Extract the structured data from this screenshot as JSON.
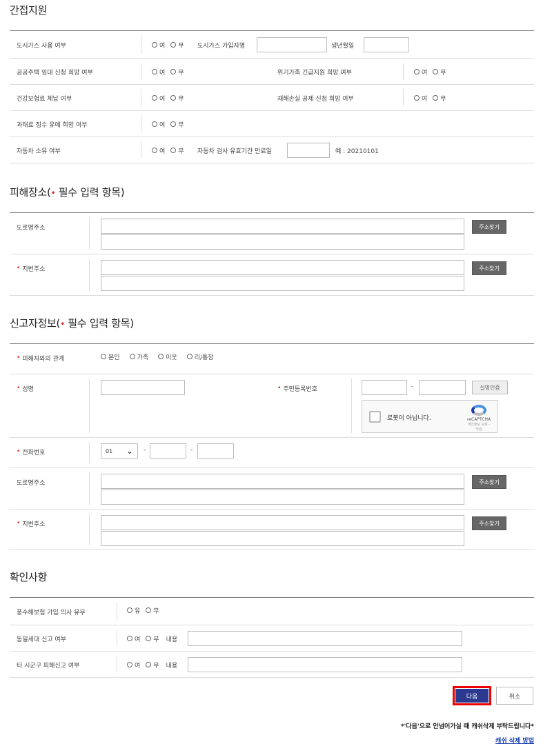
{
  "sec1": {
    "title": "간접지원",
    "yes": "여",
    "no": "무",
    "rows": [
      {
        "label": "도시가스 사용 여부",
        "sub1": "도시가스 가입자명",
        "sub2": "생년월일"
      },
      {
        "label": "공공주택 임대 신청 희망 여부",
        "right_label": "위기가족 긴급지원 희망 여부"
      },
      {
        "label": "건강보험료 체납 여부",
        "right_label": "재해손실 공제 신청 희망 여부"
      },
      {
        "label": "과태료 징수 유예 희망 여부"
      },
      {
        "label": "자동차 소유 여부",
        "sub1": "자동차 검사 유효기간 만료일",
        "example": "예 : 20210101"
      }
    ]
  },
  "sec2": {
    "title_prefix": "피해장소(",
    "star": "•",
    "title_suffix": " 필수 입력 항목)",
    "road_label": "도로명주소",
    "jibun_label": "지번주소",
    "find_btn": "주소찾기"
  },
  "sec3": {
    "title_prefix": "신고자정보(",
    "star": "•",
    "title_suffix": " 필수 입력 항목)",
    "relation_label": "피해자와의 관계",
    "relation_options": [
      "본인",
      "가족",
      "이웃",
      "리/통장"
    ],
    "name_label": "성명",
    "rrn_label": "주민등록번호",
    "verify_btn": "실명인증",
    "captcha_text": "로봇이 아닙니다.",
    "captcha_brand": "reCAPTCHA",
    "captcha_terms": "개인정보 보호 - 약관",
    "phone_label": "전화번호",
    "phone_prefix": "01",
    "road_label": "도로명주소",
    "jibun_label": "지번주소",
    "find_btn": "주소찾기",
    "dash": "-"
  },
  "sec4": {
    "title": "확인사항",
    "row1": {
      "label": "풍수해보험 가입 의사 유무",
      "yes": "유",
      "no": "무"
    },
    "row2": {
      "label": "동일세대 신고 여부",
      "yes": "여",
      "no": "무",
      "content": "내용"
    },
    "row3": {
      "label": "타 시군구 피해신고 여부",
      "yes": "여",
      "no": "무",
      "content": "내용"
    }
  },
  "actions": {
    "next": "다음",
    "cancel": "취소",
    "notice": "*'다음'으로 안넘어가실 때 캐쉬삭제 부탁드립니다*",
    "cache_link": "캐쉬 삭제 방법"
  }
}
